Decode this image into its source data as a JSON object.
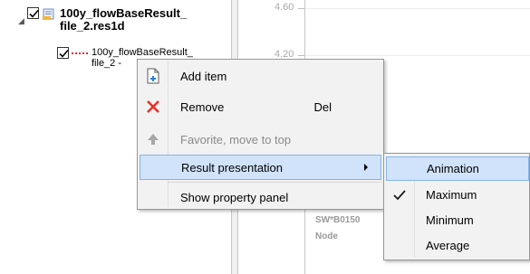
{
  "tree": {
    "parent_label": "100y_flowBaseResult_\nfile_2.res1d",
    "child_label": "100y_flowBaseResult_\nfile_2 -"
  },
  "chart": {
    "ticks": [
      "4.60",
      "4.20"
    ],
    "faded_labels": [
      "SW*B0150",
      "Node"
    ]
  },
  "context_menu": {
    "items": [
      {
        "label": "Add item",
        "shortcut": "",
        "icon": "add-item-icon",
        "disabled": false
      },
      {
        "label": "Remove",
        "shortcut": "Del",
        "icon": "remove-icon",
        "disabled": false
      },
      {
        "label": "Favorite, move to top",
        "shortcut": "",
        "icon": "arrow-up-icon",
        "disabled": true
      },
      {
        "label": "Result presentation",
        "shortcut": "",
        "icon": "",
        "disabled": false,
        "submenu": true
      },
      {
        "label": "Show property panel",
        "shortcut": "",
        "icon": "",
        "disabled": false
      }
    ]
  },
  "submenu": {
    "items": [
      {
        "label": "Animation",
        "checked": false
      },
      {
        "label": "Maximum",
        "checked": true
      },
      {
        "label": "Minimum",
        "checked": false
      },
      {
        "label": "Average",
        "checked": false
      }
    ]
  },
  "colors": {
    "highlight": "#d1e3fa",
    "highlight_border": "#86b4ea",
    "remove_red": "#e8312a",
    "menu_bg": "#f2f2f2"
  }
}
